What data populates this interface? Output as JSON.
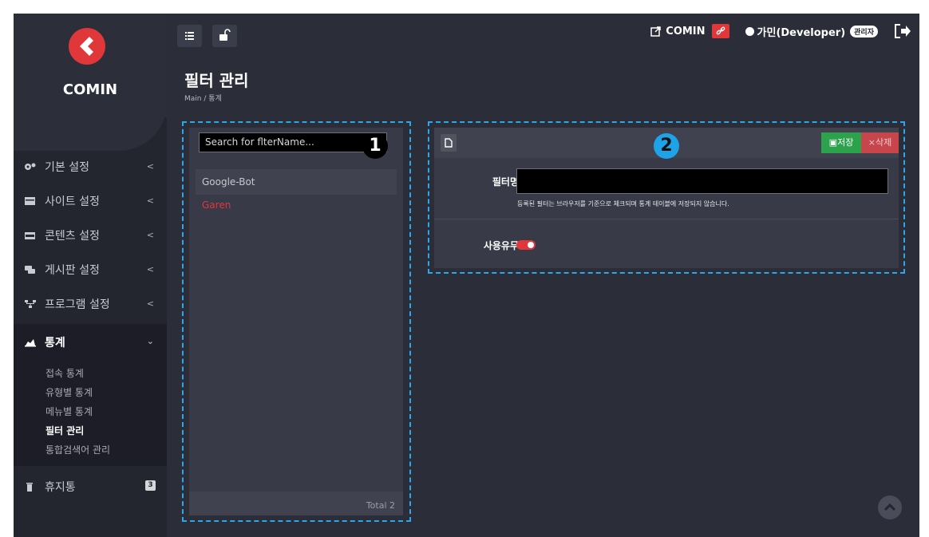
{
  "brand": {
    "name": "COMIN"
  },
  "sidebar": {
    "items": [
      {
        "label": "기본 설정",
        "icon": "gears-icon"
      },
      {
        "label": "사이트 설정",
        "icon": "window-icon"
      },
      {
        "label": "콘텐츠 설정",
        "icon": "card-icon"
      },
      {
        "label": "게시판 설정",
        "icon": "chat-icon"
      },
      {
        "label": "프로그램 설정",
        "icon": "sitemap-icon"
      }
    ],
    "active": {
      "label": "통계",
      "icon": "area-chart-icon",
      "children": [
        "접속 통계",
        "유형별 통계",
        "메뉴별 통계",
        "필터 관리",
        "통합검색어 관리"
      ],
      "current": "필터 관리"
    },
    "trash": {
      "label": "휴지통",
      "icon": "trash-icon",
      "count": "3"
    }
  },
  "header": {
    "site_link": "COMIN",
    "user": "가민(Developer)",
    "role": "관리자"
  },
  "page": {
    "title": "필터 관리",
    "breadcrumb": "Main  /  통계"
  },
  "filter_list": {
    "search_placeholder": "Search for flterName...",
    "items": [
      "Google-Bot",
      "Garen"
    ],
    "total": "Total 2",
    "badge": "1"
  },
  "editor": {
    "badge": "2",
    "save_label": "저장",
    "delete_label": "삭제",
    "name_label": "필터명",
    "name_value": "",
    "hint": "등록된 필터는 브라우저를 기준으로 체크되며 통계 테이블에 저장되지 않습니다.",
    "use_label": "사용유무",
    "use_enabled": true
  },
  "colors": {
    "accent": "#e0373a",
    "annotation": "#2aa8ea",
    "save": "#2ba24b",
    "delete": "#c7464c"
  }
}
